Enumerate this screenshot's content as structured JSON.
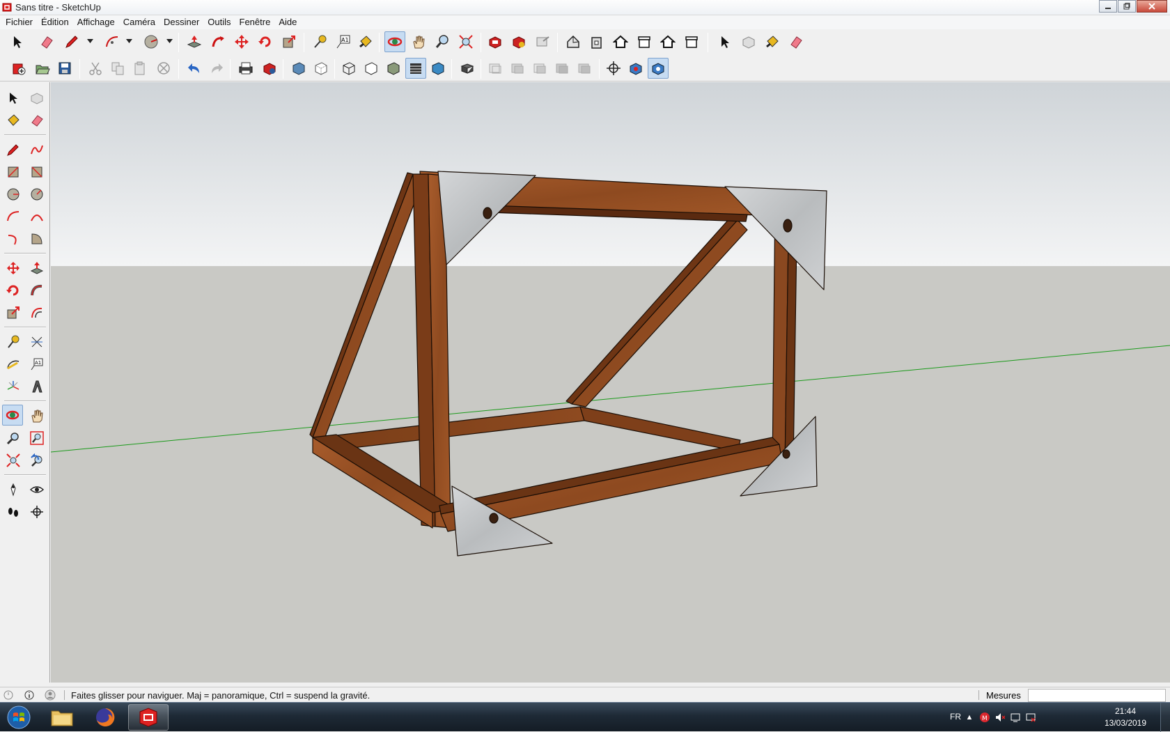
{
  "window": {
    "title": "Sans titre - SketchUp"
  },
  "menu": [
    "Fichier",
    "Édition",
    "Affichage",
    "Caméra",
    "Dessiner",
    "Outils",
    "Fenêtre",
    "Aide"
  ],
  "toolbar1": [
    "select-tool",
    "eraser-tool",
    "pencil-tool",
    "arc-tool",
    "shapes-tool",
    "push-pull-tool",
    "follow-me-tool",
    "move-tool",
    "rotate-tool",
    "scale-tool",
    "tape-measure-tool",
    "text-tool",
    "paint-bucket-tool",
    "orbit-tool",
    "pan-tool",
    "zoom-tool",
    "zoom-extents-tool",
    "3d-warehouse",
    "extension-warehouse",
    "layout-send",
    "iso-view",
    "front-view",
    "top-view",
    "right-view",
    "back-view",
    "left-view",
    "select-tool-2",
    "make-component",
    "paint-bucket-2",
    "eraser-2"
  ],
  "toolbar2": [
    "new",
    "open",
    "save",
    "cut",
    "copy",
    "paste",
    "delete",
    "undo",
    "redo",
    "print",
    "model-info",
    "xray",
    "back-edges",
    "wireframe",
    "hidden-line",
    "shaded",
    "shaded-textures",
    "monochrome",
    "outliner",
    "section-plane",
    "section-display",
    "section-cuts",
    "section-fill",
    "position-camera",
    "look-around",
    "walk"
  ],
  "status": {
    "hint": "Faites glisser pour naviguer. Maj = panoramique, Ctrl =  suspend la gravité.",
    "measure_label": "Mesures",
    "measure_value": ""
  },
  "taskbar": {
    "lang": "FR",
    "time": "21:44",
    "date": "13/03/2019"
  },
  "colors": {
    "sky_top": "#cfd4d8",
    "sky_bottom": "#f3f4f5",
    "ground": "#c9c9c5",
    "wood": "#9a5226",
    "metal": "#c3c6c8",
    "green_axis": "#1a9a1a"
  }
}
